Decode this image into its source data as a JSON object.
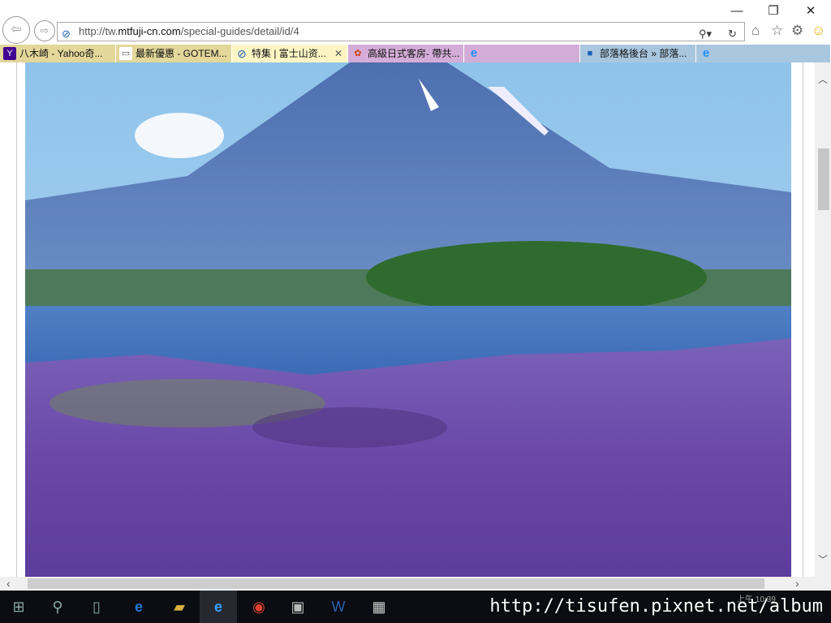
{
  "window": {
    "minimize": "—",
    "restore": "❐",
    "close": "✕"
  },
  "address": {
    "prefix": "http://tw.",
    "domain": "mtfuji-cn.com",
    "path": "/special-guides/detail/id/4"
  },
  "tabs": [
    {
      "label": "八木崎 - Yahoo奇...",
      "icon": "Y",
      "bg": "#e3d79a"
    },
    {
      "label": "最新優惠 - GOTEM...",
      "icon": "▭",
      "bg": "#e3d79a"
    },
    {
      "label": "特集 | 富士山资...",
      "icon": "⊘",
      "bg": "#fdf6c4",
      "close": "✕"
    },
    {
      "label": "高級日式客房- 帶共...",
      "icon": "✿",
      "bg": "#d4acd8"
    },
    {
      "label": "",
      "icon": "e",
      "bg": "#d4acd8"
    },
    {
      "label": "部落格後台 » 部落...",
      "icon": "■",
      "bg": "#a9c6df"
    },
    {
      "label": "",
      "icon": "e",
      "bg": "#a9c6df"
    }
  ],
  "taskbar": {
    "clock": "上午 10:39",
    "watermark": "http://tisufen.pixnet.net/album"
  }
}
